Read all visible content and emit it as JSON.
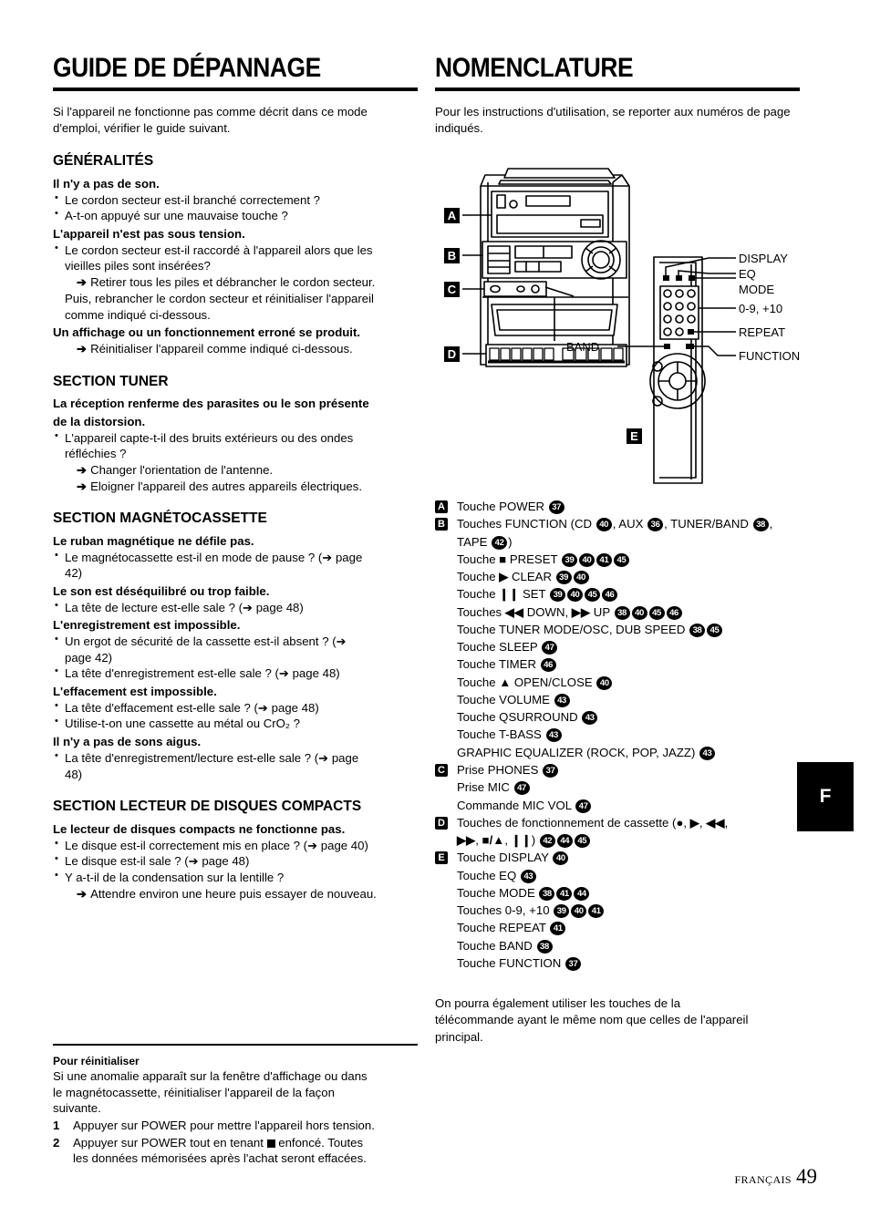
{
  "page": {
    "footer_language": "FRANÇAIS",
    "footer_page": "49",
    "side_tab": "F"
  },
  "left_column": {
    "title": "GUIDE DE DÉPANNAGE",
    "intro": "Si l'appareil ne fonctionne pas comme décrit dans ce mode d'emploi, vérifier le guide suivant.",
    "sections": [
      {
        "heading": "GÉNÉRALITÉS",
        "items": [
          {
            "type": "q",
            "text": "Il n'y a pas de son."
          },
          {
            "type": "bullet",
            "text": "Le cordon secteur est-il branché correctement ?"
          },
          {
            "type": "bullet",
            "text": "A-t-on appuyé sur une mauvaise touche ?"
          },
          {
            "type": "q",
            "text": "L'appareil n'est pas sous tension."
          },
          {
            "type": "bullet",
            "text": "Le cordon secteur est-il raccordé à l'appareil alors que les"
          },
          {
            "type": "cont",
            "text": "vieilles piles sont insérées?"
          },
          {
            "type": "arrow",
            "text": "Retirer tous les piles et débrancher le cordon secteur."
          },
          {
            "type": "plain",
            "text": "Puis, rebrancher le cordon secteur et réinitialiser l'appareil"
          },
          {
            "type": "plain",
            "text": "comme indiqué ci-dessous."
          },
          {
            "type": "q",
            "text": "Un affichage ou un fonctionnement erroné se produit."
          },
          {
            "type": "arrow",
            "text": "Réinitialiser l'appareil comme indiqué ci-dessous."
          }
        ]
      },
      {
        "heading": "SECTION TUNER",
        "items": [
          {
            "type": "q",
            "text": "La réception renferme des parasites ou le son présente"
          },
          {
            "type": "q",
            "text": "de la distorsion."
          },
          {
            "type": "bullet",
            "text": "L'appareil capte-t-il des bruits extérieurs ou des ondes"
          },
          {
            "type": "cont",
            "text": "réfléchies ?"
          },
          {
            "type": "arrow",
            "text": "Changer l'orientation de l'antenne."
          },
          {
            "type": "arrow",
            "text": "Eloigner l'appareil des autres appareils électriques."
          }
        ]
      },
      {
        "heading": "SECTION MAGNÉTOCASSETTE",
        "items": [
          {
            "type": "q",
            "text": "Le ruban magnétique ne défile pas."
          },
          {
            "type": "bullet",
            "text": "Le magnétocassette est-il en mode de pause ? (➔ page"
          },
          {
            "type": "cont",
            "text": "42)"
          },
          {
            "type": "q",
            "text": "Le son est déséquilibré ou trop faible."
          },
          {
            "type": "bullet",
            "text": "La tête de lecture est-elle sale ? (➔ page 48)"
          },
          {
            "type": "q",
            "text": "L'enregistrement est impossible."
          },
          {
            "type": "bullet",
            "text": "Un ergot de sécurité de la cassette est-il absent ? (➔"
          },
          {
            "type": "cont",
            "text": "page 42)"
          },
          {
            "type": "bullet",
            "text": "La tête d'enregistrement est-elle sale ? (➔ page 48)"
          },
          {
            "type": "q",
            "text": "L'effacement est impossible."
          },
          {
            "type": "bullet",
            "text": "La tête d'effacement est-elle sale ? (➔ page 48)"
          },
          {
            "type": "bullet",
            "text": "Utilise-t-on une cassette au métal ou CrO₂ ?"
          },
          {
            "type": "q",
            "text": "Il n'y a pas de sons aigus."
          },
          {
            "type": "bullet",
            "text": "La tête d'enregistrement/lecture est-elle sale ? (➔ page"
          },
          {
            "type": "cont",
            "text": "48)"
          }
        ]
      },
      {
        "heading": "SECTION LECTEUR DE DISQUES COMPACTS",
        "items": [
          {
            "type": "q",
            "text": "Le lecteur de disques compacts ne fonctionne pas."
          },
          {
            "type": "bullet",
            "text": "Le disque est-il correctement mis en place ? (➔ page 40)"
          },
          {
            "type": "bullet",
            "text": "Le disque est-il sale ? (➔ page 48)"
          },
          {
            "type": "bullet",
            "text": "Y a-t-il de la condensation sur la lentille ?"
          },
          {
            "type": "arrow",
            "text": "Attendre environ une heure puis essayer de nouveau."
          }
        ]
      }
    ],
    "reset": {
      "title": "Pour réinitialiser",
      "body": [
        "Si une anomalie apparaît sur la fenêtre d'affichage ou dans",
        "le magnétocassette, réinitialiser l'appareil de la façon",
        "suivante."
      ],
      "steps": [
        {
          "num": "1",
          "text": "Appuyer sur POWER pour mettre l'appareil hors tension."
        },
        {
          "num": "2",
          "text_before": "Appuyer sur POWER tout en tenant ",
          "text_after": " enfoncé. Toutes",
          "text_line2": "les données mémorisées après l'achat seront effacées."
        }
      ]
    }
  },
  "right_column": {
    "title": "NOMENCLATURE",
    "intro": "Pour les instructions d'utilisation, se reporter aux numéros de page indiqués.",
    "diagram": {
      "callout_letters": [
        "A",
        "B",
        "C",
        "D",
        "E"
      ],
      "remote_labels": [
        "DISPLAY",
        "EQ",
        "MODE",
        "0-9, +10",
        "REPEAT",
        "FUNCTION",
        "BAND"
      ]
    },
    "nomenclature": [
      {
        "letter": "A",
        "parts": [
          {
            "t": "Touche POWER "
          },
          {
            "c": "37"
          }
        ]
      },
      {
        "letter": "B",
        "parts": [
          {
            "t": "Touches FUNCTION (CD "
          },
          {
            "c": "40"
          },
          {
            "t": ", AUX "
          },
          {
            "c": "36"
          },
          {
            "t": ", TUNER/BAND "
          },
          {
            "c": "38"
          },
          {
            "t": ","
          }
        ]
      },
      {
        "letter": "",
        "parts": [
          {
            "t": "TAPE "
          },
          {
            "c": "42"
          },
          {
            "t": ")"
          }
        ]
      },
      {
        "letter": "",
        "parts": [
          {
            "t": "Touche "
          },
          {
            "g": "■"
          },
          {
            "t": " PRESET "
          },
          {
            "c": "39"
          },
          {
            "c": "40"
          },
          {
            "c": "41"
          },
          {
            "c": "45"
          }
        ]
      },
      {
        "letter": "",
        "parts": [
          {
            "t": "Touche "
          },
          {
            "g": "▶"
          },
          {
            "t": " CLEAR "
          },
          {
            "c": "39"
          },
          {
            "c": "40"
          }
        ]
      },
      {
        "letter": "",
        "parts": [
          {
            "t": "Touche "
          },
          {
            "g": "❙❙"
          },
          {
            "t": " SET "
          },
          {
            "c": "39"
          },
          {
            "c": "40"
          },
          {
            "c": "45"
          },
          {
            "c": "46"
          }
        ]
      },
      {
        "letter": "",
        "parts": [
          {
            "t": "Touches "
          },
          {
            "g": "◀◀"
          },
          {
            "t": " DOWN, "
          },
          {
            "g": "▶▶"
          },
          {
            "t": " UP "
          },
          {
            "c": "38"
          },
          {
            "c": "40"
          },
          {
            "c": "45"
          },
          {
            "c": "46"
          }
        ]
      },
      {
        "letter": "",
        "parts": [
          {
            "t": "Touche TUNER MODE/OSC, DUB SPEED "
          },
          {
            "c": "38"
          },
          {
            "c": "45"
          }
        ]
      },
      {
        "letter": "",
        "parts": [
          {
            "t": "Touche SLEEP "
          },
          {
            "c": "47"
          }
        ]
      },
      {
        "letter": "",
        "parts": [
          {
            "t": "Touche TIMER "
          },
          {
            "c": "46"
          }
        ]
      },
      {
        "letter": "",
        "parts": [
          {
            "t": "Touche "
          },
          {
            "g": "▲"
          },
          {
            "t": " OPEN/CLOSE "
          },
          {
            "c": "40"
          }
        ]
      },
      {
        "letter": "",
        "parts": [
          {
            "t": "Touche VOLUME "
          },
          {
            "c": "43"
          }
        ]
      },
      {
        "letter": "",
        "parts": [
          {
            "t": "Touche QSURROUND "
          },
          {
            "c": "43"
          }
        ]
      },
      {
        "letter": "",
        "parts": [
          {
            "t": "Touche T-BASS "
          },
          {
            "c": "43"
          }
        ]
      },
      {
        "letter": "",
        "parts": [
          {
            "t": "GRAPHIC EQUALIZER (ROCK, POP, JAZZ) "
          },
          {
            "c": "43"
          }
        ]
      },
      {
        "letter": "C",
        "parts": [
          {
            "t": "Prise PHONES "
          },
          {
            "c": "37"
          }
        ]
      },
      {
        "letter": "",
        "parts": [
          {
            "t": "Prise MIC "
          },
          {
            "c": "47"
          }
        ]
      },
      {
        "letter": "",
        "parts": [
          {
            "t": "Commande MIC VOL "
          },
          {
            "c": "47"
          }
        ]
      },
      {
        "letter": "D",
        "parts": [
          {
            "t": "Touches de fonctionnement de cassette ("
          },
          {
            "g": "●"
          },
          {
            "t": ", "
          },
          {
            "g": "▶"
          },
          {
            "t": ", "
          },
          {
            "g": "◀◀"
          },
          {
            "t": ","
          }
        ]
      },
      {
        "letter": "",
        "parts": [
          {
            "g": "▶▶"
          },
          {
            "t": ", "
          },
          {
            "g": "■/▲"
          },
          {
            "t": ", "
          },
          {
            "g": "❙❙"
          },
          {
            "t": ") "
          },
          {
            "c": "42"
          },
          {
            "c": "44"
          },
          {
            "c": "45"
          }
        ]
      },
      {
        "letter": "E",
        "parts": [
          {
            "t": "Touche DISPLAY "
          },
          {
            "c": "40"
          }
        ]
      },
      {
        "letter": "",
        "parts": [
          {
            "t": "Touche EQ "
          },
          {
            "c": "43"
          }
        ]
      },
      {
        "letter": "",
        "parts": [
          {
            "t": "Touche MODE "
          },
          {
            "c": "38"
          },
          {
            "c": "41"
          },
          {
            "c": "44"
          }
        ]
      },
      {
        "letter": "",
        "parts": [
          {
            "t": "Touches 0-9, +10 "
          },
          {
            "c": "39"
          },
          {
            "c": "40"
          },
          {
            "c": "41"
          }
        ]
      },
      {
        "letter": "",
        "parts": [
          {
            "t": "Touche REPEAT "
          },
          {
            "c": "41"
          }
        ]
      },
      {
        "letter": "",
        "parts": [
          {
            "t": "Touche BAND "
          },
          {
            "c": "38"
          }
        ]
      },
      {
        "letter": "",
        "parts": [
          {
            "t": "Touche FUNCTION "
          },
          {
            "c": "37"
          }
        ]
      }
    ],
    "tail_note": [
      "On pourra également utiliser les touches de la",
      "télécommande ayant le même nom que celles de l'appareil",
      "principal."
    ]
  }
}
